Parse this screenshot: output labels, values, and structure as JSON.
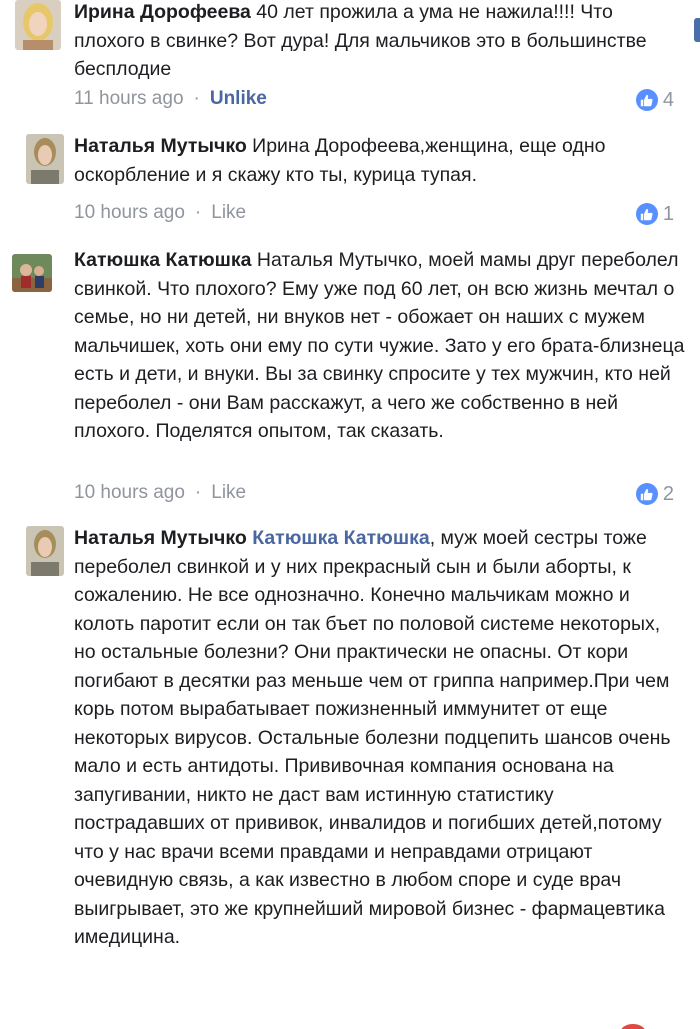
{
  "comments": [
    {
      "author": "Ирина Дорофеева",
      "mention": "",
      "text": " 40 лет прожила а ума не нажила!!!! Что плохого в свинке? Вот дура! Для мальчиков это в большинстве бесплодие",
      "time": "11 hours ago",
      "separator": "·",
      "like_label": "Unlike",
      "like_count": "4",
      "avatar_icon": "user-avatar-blonde"
    },
    {
      "author": "Наталья Мутычко",
      "mention": "",
      "text": " Ирина Дорофеева,женщина, еще одно оскорбление и я скажу кто ты, курица тупая.",
      "time": "10 hours ago",
      "separator": "·",
      "like_label": "Like",
      "like_count": "1",
      "avatar_icon": "user-avatar-portrait"
    },
    {
      "author": "Катюшка Катюшка",
      "mention": "",
      "text": " Наталья Мутычко, моей мамы друг переболел свинкой. Что плохого? Ему уже под 60 лет, он всю жизнь мечтал о семье, но ни детей, ни внуков нет - обожает он наших с мужем мальчишек, хоть они ему по сути чужие. Зато у его брата-близнеца есть и дети, и внуки. Вы за свинку спросите у тех мужчин, кто ней переболел - они Вам расскажут, а чего же собственно в ней плохого. Поделятся опытом, так сказать.",
      "time": "10 hours ago",
      "separator": "·",
      "like_label": "Like",
      "like_count": "2",
      "avatar_icon": "user-avatar-group"
    },
    {
      "author": "Наталья Мутычко",
      "mention": "Катюшка Катюшка",
      "text": ", муж моей сестры тоже переболел свинкой и у них прекрасный сын и были аборты, к сожалению. Не все однозначно. Конечно мальчикам можно и колоть паротит если он так бъет по половой системе некоторых, но остальные болезни? Они практически не опасны. От кори погибают в десятки раз меньше чем от гриппа например.При чем корь  потом вырабатывает пожизненный иммунитет от еще некоторых вирусов. Остальные болезни подцепить шансов очень мало и есть антидоты. Прививочная компания основана на запугивании, никто не даст вам истинную статистику пострадавших от прививок, инвалидов и погибших детей,потому что у нас врачи всеми правдами и неправдами отрицают очевидную связь, а как известно в любом споре и суде врач выигрывает, это же крупнейший мировой бизнес - фармацевтика имедицина.",
      "avatar_icon": "user-avatar-portrait"
    }
  ],
  "colors": {
    "link": "#4b67a1",
    "meta": "#90949c",
    "like_badge": "#5890ff"
  }
}
